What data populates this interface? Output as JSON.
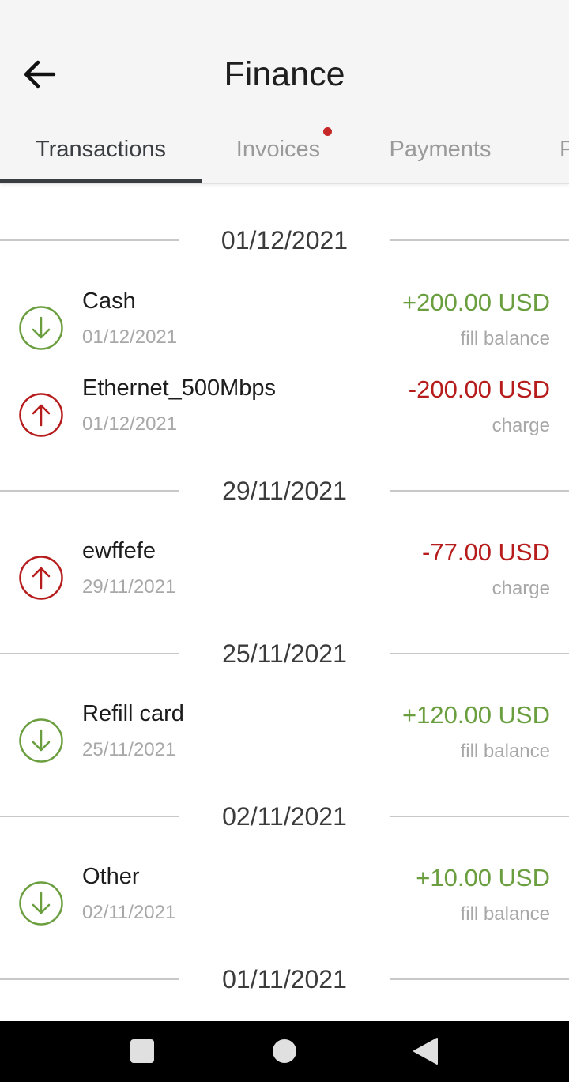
{
  "header": {
    "title": "Finance",
    "back_icon": "arrow-left-icon"
  },
  "tabs": [
    {
      "label": "Transactions",
      "active": true
    },
    {
      "label": "Invoices",
      "active": false,
      "has_notification_dot": true
    },
    {
      "label": "Payments",
      "active": false
    },
    {
      "label": "P",
      "active": false
    }
  ],
  "groups": [
    {
      "date": "01/12/2021",
      "items": [
        {
          "title": "Cash",
          "date": "01/12/2021",
          "amount": "+200.00 USD",
          "kind": "fill balance",
          "direction": "in",
          "icon": "arrow-down-circle-icon"
        },
        {
          "title": "Ethernet_500Mbps",
          "date": "01/12/2021",
          "amount": "-200.00 USD",
          "kind": "charge",
          "direction": "out",
          "icon": "arrow-up-circle-icon"
        }
      ]
    },
    {
      "date": "29/11/2021",
      "items": [
        {
          "title": "ewffefe",
          "date": "29/11/2021",
          "amount": "-77.00 USD",
          "kind": "charge",
          "direction": "out",
          "icon": "arrow-up-circle-icon"
        }
      ]
    },
    {
      "date": "25/11/2021",
      "items": [
        {
          "title": "Refill card",
          "date": "25/11/2021",
          "amount": "+120.00 USD",
          "kind": "fill balance",
          "direction": "in",
          "icon": "arrow-down-circle-icon"
        }
      ]
    },
    {
      "date": "02/11/2021",
      "items": [
        {
          "title": "Other",
          "date": "02/11/2021",
          "amount": "+10.00 USD",
          "kind": "fill balance",
          "direction": "in",
          "icon": "arrow-down-circle-icon"
        }
      ]
    },
    {
      "date": "01/11/2021",
      "items": []
    }
  ],
  "colors": {
    "income": "#6a9e3f",
    "charge": "#b71c1c",
    "notification_dot": "#c62828",
    "active_tab": "#3a3d42"
  },
  "system_nav": {
    "recents_icon": "square-icon",
    "home_icon": "circle-icon",
    "back_icon": "triangle-back-icon"
  }
}
